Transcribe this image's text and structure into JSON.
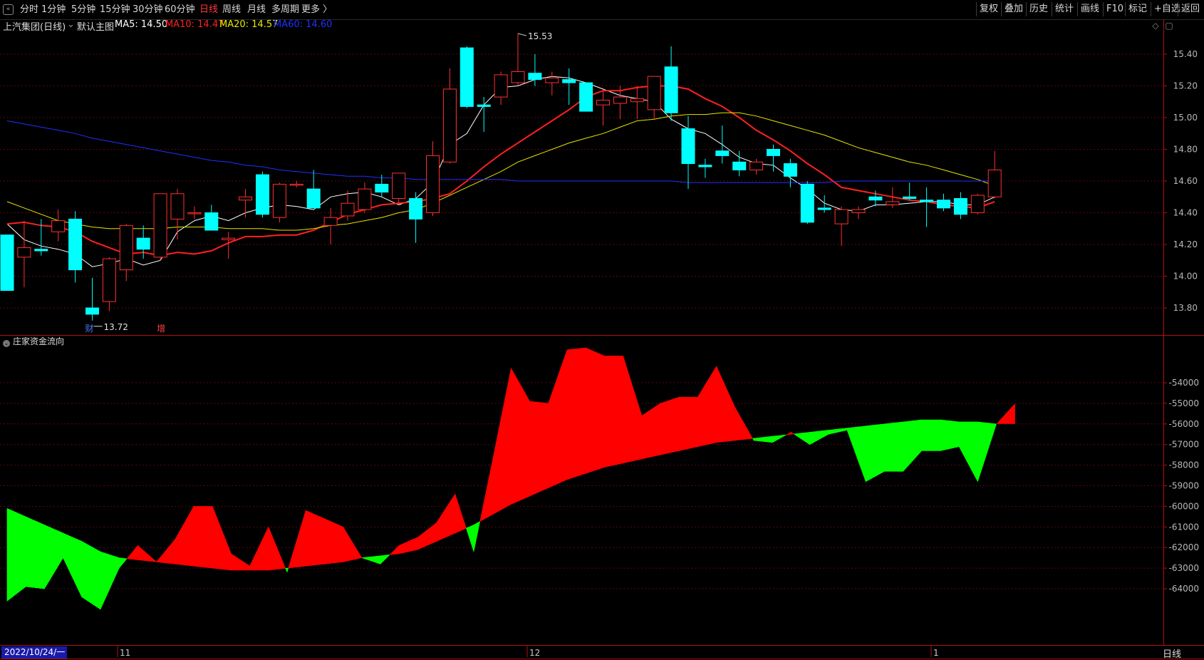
{
  "toolbar": {
    "left_items": [
      "分时",
      "1分钟",
      "5分钟",
      "15分钟",
      "30分钟",
      "60分钟",
      "日线",
      "周线",
      "月线",
      "多周期",
      "更多 〉"
    ],
    "active": "日线",
    "right_items": [
      "复权",
      "叠加",
      "历史",
      "统计",
      "画线",
      "F10",
      "标记",
      "+自选",
      "返回"
    ]
  },
  "infobar": {
    "stock_name": "上汽集团(日线)",
    "template": "默认主图",
    "ma5": "MA5: 14.50",
    "ma10": "MA10: 14.47",
    "ma20": "MA20: 14.57",
    "ma60": "MA60: 14.60"
  },
  "indicator_title": "庄家资金流向",
  "bottom": {
    "date": "2022/10/24/一",
    "period": "日线"
  },
  "colors": {
    "up": "#ff3030",
    "down": "#00ffff",
    "ma5": "#ffffff",
    "ma10": "#ff2020",
    "ma20": "#e6e600",
    "ma60": "#2030ff",
    "flow_pos": "#ff0000",
    "flow_neg": "#00ff00"
  },
  "chart_data": [
    {
      "type": "candlestick",
      "ylim": [
        13.7,
        15.5
      ],
      "y_ticks": [
        13.8,
        14.0,
        14.2,
        14.4,
        14.6,
        14.8,
        15.0,
        15.2,
        15.4
      ],
      "x_ticks": [
        "11",
        "12",
        "1"
      ],
      "annotations": {
        "high": "15.53",
        "low": "13.72",
        "markers": [
          "财",
          "增"
        ]
      },
      "candles": [
        {
          "o": 14.26,
          "h": 14.26,
          "l": 13.91,
          "c": 13.91
        },
        {
          "o": 14.12,
          "h": 14.35,
          "l": 13.93,
          "c": 14.18
        },
        {
          "o": 14.17,
          "h": 14.36,
          "l": 14.13,
          "c": 14.16
        },
        {
          "o": 14.28,
          "h": 14.42,
          "l": 14.22,
          "c": 14.35
        },
        {
          "o": 14.36,
          "h": 14.41,
          "l": 13.96,
          "c": 14.04
        },
        {
          "o": 13.8,
          "h": 13.99,
          "l": 13.72,
          "c": 13.76
        },
        {
          "o": 13.84,
          "h": 14.12,
          "l": 13.78,
          "c": 14.11
        },
        {
          "o": 14.04,
          "h": 14.33,
          "l": 13.97,
          "c": 14.32
        },
        {
          "o": 14.24,
          "h": 14.32,
          "l": 14.11,
          "c": 14.17
        },
        {
          "o": 14.12,
          "h": 14.52,
          "l": 14.1,
          "c": 14.52
        },
        {
          "o": 14.36,
          "h": 14.55,
          "l": 14.23,
          "c": 14.52
        },
        {
          "o": 14.4,
          "h": 14.44,
          "l": 14.36,
          "c": 14.4
        },
        {
          "o": 14.4,
          "h": 14.45,
          "l": 14.3,
          "c": 14.29
        },
        {
          "o": 14.23,
          "h": 14.28,
          "l": 14.11,
          "c": 14.24
        },
        {
          "o": 14.48,
          "h": 14.55,
          "l": 14.37,
          "c": 14.5
        },
        {
          "o": 14.64,
          "h": 14.66,
          "l": 14.37,
          "c": 14.39
        },
        {
          "o": 14.37,
          "h": 14.59,
          "l": 14.34,
          "c": 14.58
        },
        {
          "o": 14.58,
          "h": 14.6,
          "l": 14.56,
          "c": 14.58
        },
        {
          "o": 14.55,
          "h": 14.67,
          "l": 14.52,
          "c": 14.43
        },
        {
          "o": 14.32,
          "h": 14.43,
          "l": 14.2,
          "c": 14.37
        },
        {
          "o": 14.38,
          "h": 14.54,
          "l": 14.35,
          "c": 14.46
        },
        {
          "o": 14.42,
          "h": 14.59,
          "l": 14.4,
          "c": 14.55
        },
        {
          "o": 14.58,
          "h": 14.64,
          "l": 14.5,
          "c": 14.53
        },
        {
          "o": 14.49,
          "h": 14.65,
          "l": 14.45,
          "c": 14.65
        },
        {
          "o": 14.49,
          "h": 14.53,
          "l": 14.21,
          "c": 14.36
        },
        {
          "o": 14.4,
          "h": 14.85,
          "l": 14.38,
          "c": 14.76
        },
        {
          "o": 14.72,
          "h": 15.31,
          "l": 14.71,
          "c": 15.18
        },
        {
          "o": 15.44,
          "h": 15.45,
          "l": 15.06,
          "c": 15.07
        },
        {
          "o": 15.08,
          "h": 15.13,
          "l": 14.91,
          "c": 15.07
        },
        {
          "o": 15.13,
          "h": 15.29,
          "l": 15.08,
          "c": 15.27
        },
        {
          "o": 15.22,
          "h": 15.53,
          "l": 15.2,
          "c": 15.29
        },
        {
          "o": 15.28,
          "h": 15.4,
          "l": 15.2,
          "c": 15.24
        },
        {
          "o": 15.22,
          "h": 15.29,
          "l": 15.14,
          "c": 15.25
        },
        {
          "o": 15.24,
          "h": 15.31,
          "l": 15.08,
          "c": 15.22
        },
        {
          "o": 15.22,
          "h": 15.22,
          "l": 15.04,
          "c": 15.04
        },
        {
          "o": 15.08,
          "h": 15.17,
          "l": 14.95,
          "c": 15.11
        },
        {
          "o": 15.09,
          "h": 15.2,
          "l": 14.99,
          "c": 15.13
        },
        {
          "o": 15.1,
          "h": 15.2,
          "l": 14.99,
          "c": 15.12
        },
        {
          "o": 15.05,
          "h": 15.26,
          "l": 14.99,
          "c": 15.26
        },
        {
          "o": 15.32,
          "h": 15.45,
          "l": 14.98,
          "c": 15.03
        },
        {
          "o": 14.93,
          "h": 15.01,
          "l": 14.55,
          "c": 14.71
        },
        {
          "o": 14.7,
          "h": 14.74,
          "l": 14.62,
          "c": 14.69
        },
        {
          "o": 14.79,
          "h": 14.95,
          "l": 14.71,
          "c": 14.76
        },
        {
          "o": 14.72,
          "h": 14.79,
          "l": 14.63,
          "c": 14.67
        },
        {
          "o": 14.67,
          "h": 14.74,
          "l": 14.64,
          "c": 14.72
        },
        {
          "o": 14.8,
          "h": 14.83,
          "l": 14.66,
          "c": 14.76
        },
        {
          "o": 14.71,
          "h": 14.74,
          "l": 14.56,
          "c": 14.63
        },
        {
          "o": 14.58,
          "h": 14.6,
          "l": 14.33,
          "c": 14.34
        },
        {
          "o": 14.43,
          "h": 14.51,
          "l": 14.4,
          "c": 14.42
        },
        {
          "o": 14.33,
          "h": 14.44,
          "l": 14.19,
          "c": 14.42
        },
        {
          "o": 14.4,
          "h": 14.44,
          "l": 14.36,
          "c": 14.42
        },
        {
          "o": 14.5,
          "h": 14.54,
          "l": 14.44,
          "c": 14.48
        },
        {
          "o": 14.45,
          "h": 14.56,
          "l": 14.43,
          "c": 14.47
        },
        {
          "o": 14.5,
          "h": 14.59,
          "l": 14.48,
          "c": 14.49
        },
        {
          "o": 14.48,
          "h": 14.56,
          "l": 14.31,
          "c": 14.47
        },
        {
          "o": 14.48,
          "h": 14.52,
          "l": 14.41,
          "c": 14.43
        },
        {
          "o": 14.49,
          "h": 14.53,
          "l": 14.36,
          "c": 14.39
        },
        {
          "o": 14.4,
          "h": 14.52,
          "l": 14.39,
          "c": 14.51
        },
        {
          "o": 14.5,
          "h": 14.79,
          "l": 14.49,
          "c": 14.67
        }
      ],
      "ma_series": [
        {
          "name": "MA5",
          "values": [
            14.33,
            14.23,
            14.19,
            14.17,
            14.14,
            14.06,
            14.08,
            14.11,
            14.07,
            14.1,
            14.28,
            14.35,
            14.38,
            14.35,
            14.4,
            14.43,
            14.45,
            14.44,
            14.42,
            14.5,
            14.52,
            14.53,
            14.5,
            14.45,
            14.49,
            14.59,
            14.83,
            14.9,
            15.08,
            15.19,
            15.2,
            15.24,
            15.26,
            15.25,
            15.22,
            15.18,
            15.14,
            15.12,
            15.1,
            14.99,
            14.93,
            14.9,
            14.83,
            14.75,
            14.71,
            14.7,
            14.62,
            14.55,
            14.46,
            14.42,
            14.41,
            14.45,
            14.45,
            14.46,
            14.47,
            14.47,
            14.45,
            14.45,
            14.5
          ]
        },
        {
          "name": "MA10",
          "values": [
            14.33,
            14.34,
            14.32,
            14.31,
            14.28,
            14.22,
            14.18,
            14.14,
            14.15,
            14.13,
            14.15,
            14.14,
            14.16,
            14.21,
            14.25,
            14.25,
            14.26,
            14.26,
            14.29,
            14.34,
            14.39,
            14.42,
            14.45,
            14.46,
            14.47,
            14.49,
            14.52,
            14.6,
            14.69,
            14.77,
            14.84,
            14.91,
            14.98,
            15.05,
            15.13,
            15.17,
            15.17,
            15.19,
            15.2,
            15.2,
            15.18,
            15.12,
            15.07,
            15.0,
            14.92,
            14.86,
            14.79,
            14.71,
            14.64,
            14.56,
            14.54,
            14.52,
            14.5,
            14.48,
            14.47,
            14.45,
            14.44,
            14.43,
            14.47
          ]
        },
        {
          "name": "MA20",
          "values": [
            14.47,
            14.43,
            14.39,
            14.35,
            14.33,
            14.31,
            14.3,
            14.3,
            14.3,
            14.3,
            14.31,
            14.31,
            14.31,
            14.3,
            14.3,
            14.3,
            14.29,
            14.29,
            14.3,
            14.32,
            14.33,
            14.35,
            14.37,
            14.4,
            14.42,
            14.46,
            14.51,
            14.56,
            14.61,
            14.66,
            14.72,
            14.76,
            14.8,
            14.84,
            14.87,
            14.9,
            14.94,
            14.98,
            14.99,
            15.01,
            15.02,
            15.02,
            15.03,
            15.03,
            15.01,
            14.98,
            14.95,
            14.92,
            14.89,
            14.85,
            14.81,
            14.78,
            14.75,
            14.72,
            14.7,
            14.67,
            14.64,
            14.61,
            14.57
          ]
        },
        {
          "name": "MA60",
          "values": [
            14.98,
            14.96,
            14.94,
            14.92,
            14.9,
            14.87,
            14.85,
            14.83,
            14.81,
            14.79,
            14.77,
            14.75,
            14.73,
            14.72,
            14.7,
            14.69,
            14.67,
            14.66,
            14.65,
            14.64,
            14.63,
            14.63,
            14.62,
            14.62,
            14.61,
            14.61,
            14.61,
            14.61,
            14.61,
            14.61,
            14.6,
            14.6,
            14.6,
            14.6,
            14.6,
            14.6,
            14.6,
            14.6,
            14.6,
            14.6,
            14.59,
            14.59,
            14.59,
            14.59,
            14.59,
            14.59,
            14.59,
            14.59,
            14.59,
            14.6,
            14.6,
            14.6,
            14.6,
            14.6,
            14.6,
            14.6,
            14.6,
            14.6,
            14.6
          ]
        }
      ]
    },
    {
      "type": "area",
      "title": "庄家资金流向",
      "ylim": [
        -65000,
        -52000
      ],
      "y_ticks": [
        -54000,
        -55000,
        -56000,
        -57000,
        -58000,
        -59000,
        -60000,
        -61000,
        -62000,
        -63000,
        -64000
      ],
      "series": [
        {
          "values": [
            -60100,
            -60500,
            -60900,
            -61300,
            -61700,
            -62200,
            -62500,
            -62600,
            -62700,
            -62800,
            -62900,
            -63000,
            -63100,
            -63100,
            -63100,
            -63000,
            -62900,
            -62800,
            -62700,
            -62500,
            -62400,
            -62300,
            -62100,
            -61700,
            -61300,
            -60900,
            -60400,
            -59900,
            -59500,
            -59100,
            -58700,
            -58400,
            -58100,
            -57900,
            -57700,
            -57500,
            -57300,
            -57100,
            -56900,
            -56800,
            -56700,
            -56600,
            -56500,
            -56400,
            -56300,
            -56200,
            -56100,
            -56000,
            -55900,
            -55800,
            -55800,
            -55900,
            -55900,
            -56000
          ]
        },
        {
          "values": [
            -64600,
            -63900,
            -64000,
            -62500,
            -64400,
            -65000,
            -63000,
            -61900,
            -62700,
            -61600,
            -60000,
            -60000,
            -62300,
            -62900,
            -61000,
            -63200,
            -60200,
            -60600,
            -61000,
            -62500,
            -62800,
            -61900,
            -61500,
            -60800,
            -59400,
            -62200,
            -57800,
            -53300,
            -54900,
            -55000,
            -52400,
            -52300,
            -52700,
            -52700,
            -55600,
            -55000,
            -54700,
            -54700,
            -53200,
            -55200,
            -56800,
            -56900,
            -56400,
            -57000,
            -56500,
            -56300,
            -58800,
            -58300,
            -58300,
            -57300,
            -57300,
            -57100,
            -58800,
            -56000,
            -55000
          ]
        }
      ]
    }
  ]
}
